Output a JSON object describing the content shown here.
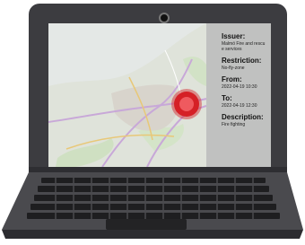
{
  "screen": {
    "map": {
      "marker_color": "#d52026",
      "water_color": "#e4e8e6",
      "land_color": "#dfe3da",
      "road_color": "#c8a8d8"
    },
    "info": {
      "issuer_label": "Issuer:",
      "issuer_value": "Malmö Fire and rescue services",
      "restriction_label": "Restriction:",
      "restriction_value": "No-fly-zone",
      "from_label": "From:",
      "from_value": "2022-04-19 10:30",
      "to_label": "To:",
      "to_value": "2022-04-19 12:30",
      "description_label": "Description:",
      "description_value": "Fire fighting"
    }
  },
  "icons": [
    "webcam-icon",
    "location-marker-icon"
  ]
}
